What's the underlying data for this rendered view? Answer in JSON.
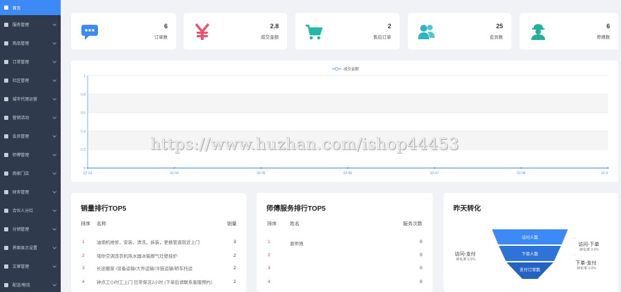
{
  "sidebar": {
    "items": [
      {
        "label": "首页",
        "icon": "home-icon"
      },
      {
        "label": "服务管理",
        "icon": "service-icon"
      },
      {
        "label": "商品管理",
        "icon": "goods-icon"
      },
      {
        "label": "订单管理",
        "icon": "order-icon"
      },
      {
        "label": "社区管理",
        "icon": "community-icon"
      },
      {
        "label": "城市代理运营",
        "icon": "agent-icon"
      },
      {
        "label": "营销活动",
        "icon": "marketing-icon"
      },
      {
        "label": "会员管理",
        "icon": "member-icon"
      },
      {
        "label": "师傅管理",
        "icon": "worker-icon"
      },
      {
        "label": "商家门店",
        "icon": "store-icon"
      },
      {
        "label": "财务管理",
        "icon": "finance-icon"
      },
      {
        "label": "合伙人分红",
        "icon": "partner-icon"
      },
      {
        "label": "分销管理",
        "icon": "distribution-icon"
      },
      {
        "label": "界面显示设置",
        "icon": "display-icon"
      },
      {
        "label": "文章管理",
        "icon": "article-icon"
      },
      {
        "label": "配送/物流",
        "icon": "delivery-icon"
      }
    ]
  },
  "stats": [
    {
      "value": "6",
      "label": "订单数",
      "icon": "chat-bubble-icon",
      "color": "#3d8af7"
    },
    {
      "value": "2.8",
      "label": "成交金额",
      "icon": "yen-icon",
      "color": "#f0506e"
    },
    {
      "value": "2",
      "label": "售后订单",
      "icon": "cart-icon",
      "color": "#22b8a8"
    },
    {
      "value": "25",
      "label": "会员数",
      "icon": "users-icon",
      "color": "#2cb5c4"
    },
    {
      "value": "6",
      "label": "师傅数",
      "icon": "worker-icon",
      "color": "#22b09a"
    }
  ],
  "chart_data": {
    "type": "line",
    "title": "",
    "series": [
      {
        "name": "成交金额",
        "values": [
          0,
          0,
          0,
          0,
          0,
          0,
          0
        ]
      }
    ],
    "categories": [
      "02 03",
      "02 04",
      "02 05",
      "02 06",
      "02 07",
      "02 08",
      "02 0"
    ],
    "y_ticks": [
      "0",
      "0.2",
      "0.4",
      "0.6",
      "0.8",
      "1"
    ],
    "ylim": [
      0,
      1
    ],
    "grid": true,
    "legend": "top-center",
    "color": "#5b9bf0"
  },
  "sales_top5": {
    "title": "销量排行TOP5",
    "headers": {
      "rank": "排序",
      "name": "名称",
      "qty": "销量"
    },
    "rows": [
      {
        "rank": "1",
        "name": "油烟机维修，安装，清洗，拆装，更换管道就近上门",
        "qty": "3"
      },
      {
        "rank": "2",
        "name": "堵你空调洗衣机热水器冰箱燃气灶壁挂炉",
        "qty": "2"
      },
      {
        "rank": "3",
        "name": "长途搬家 /设备运输/大件运输/冷链运输/轿车托运",
        "qty": "2"
      },
      {
        "rank": "4",
        "name": "钟点工小时工上门 日常保洁2小时 (下单后请联系客服预约）",
        "qty": "2"
      }
    ]
  },
  "worker_top5": {
    "title": "师傅服务排行TOP5",
    "headers": {
      "rank": "排序",
      "name": "姓名",
      "count": "服务次数"
    },
    "rows": [
      {
        "rank": "1",
        "name": "谢师傅",
        "count": "0"
      },
      {
        "rank": "2",
        "name": "",
        "count": "0"
      },
      {
        "rank": "3",
        "name": "",
        "count": "0"
      },
      {
        "rank": "4",
        "name": "",
        "count": "0"
      }
    ]
  },
  "conversion": {
    "title": "昨天转化",
    "funnel": [
      "访问人数",
      "下单人数",
      "支付订单数"
    ],
    "left_label": "访问-支付",
    "left_rate": "转化率 0.0%",
    "right1_label": "访问-下单",
    "right1_rate": "转化率 0.0%",
    "right2_label": "下单-支付",
    "right2_rate": "转化率 0.0%"
  },
  "watermark": "https://www.huzhan.com/ishop44453"
}
